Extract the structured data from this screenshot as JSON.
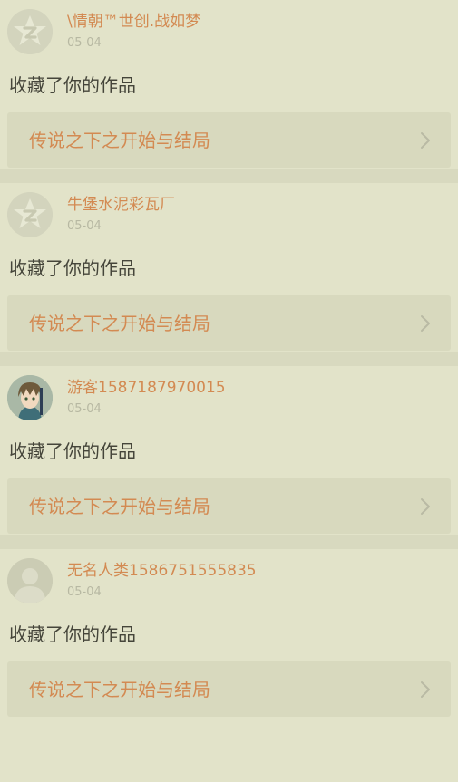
{
  "feed": [
    {
      "avatar": "qq-star-avatar-icon",
      "username": "\\情朝™世创.战如梦",
      "date": "05-04",
      "action": "收藏了你的作品",
      "work_title": "传说之下之开始与结局"
    },
    {
      "avatar": "qq-star-avatar-icon",
      "username": "牛堡水泥彩瓦厂",
      "date": "05-04",
      "action": "收藏了你的作品",
      "work_title": "传说之下之开始与结局"
    },
    {
      "avatar": "anime-character-avatar",
      "username": "游客1587187970015",
      "date": "05-04",
      "action": "收藏了你的作品",
      "work_title": "传说之下之开始与结局"
    },
    {
      "avatar": "default-person-avatar-icon",
      "username": "无名人类1586751555835",
      "date": "05-04",
      "action": "收藏了你的作品",
      "work_title": "传说之下之开始与结局"
    }
  ],
  "colors": {
    "background": "#e2e3c9",
    "divider": "#d8d9bf",
    "accent": "#d38a52",
    "date": "#b7b8a2",
    "text": "#45453a",
    "link_bg": "#d8d9be"
  }
}
